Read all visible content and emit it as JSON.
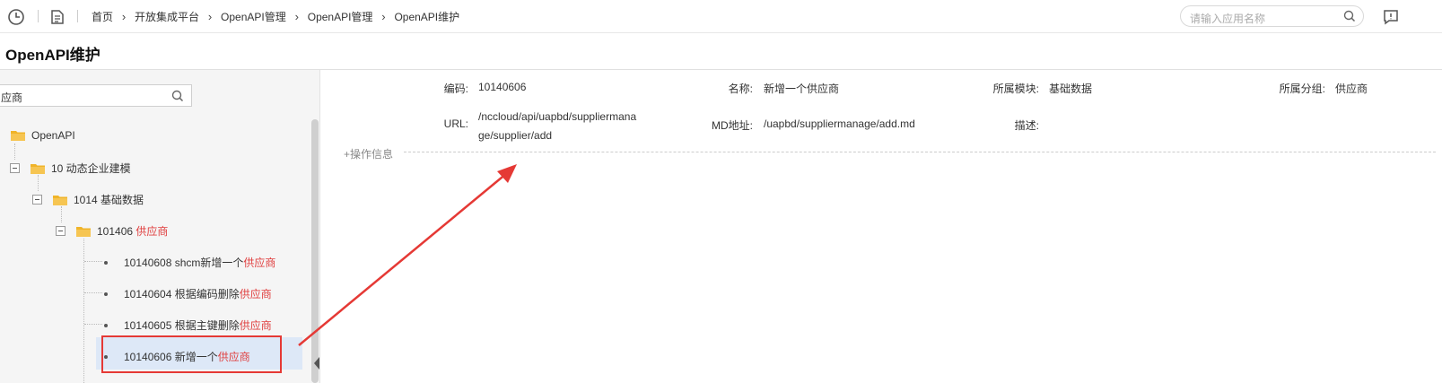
{
  "header": {
    "breadcrumb": [
      "首页",
      "开放集成平台",
      "OpenAPI管理",
      "OpenAPI管理",
      "OpenAPI维护"
    ],
    "search_placeholder": "请输入应用名称"
  },
  "page": {
    "title": "OpenAPI维护"
  },
  "tree": {
    "search_value": "应商",
    "nodes": {
      "root": {
        "label": "OpenAPI"
      },
      "n10": {
        "label": "10 动态企业建模"
      },
      "n1014": {
        "label": "1014 基础数据"
      },
      "n101406": {
        "code": "101406 ",
        "match": "供应商"
      },
      "leaf1": {
        "prefix": "10140608 shcm新增一个",
        "match": "供应商"
      },
      "leaf2": {
        "prefix": "10140604 根据编码删除",
        "match": "供应商"
      },
      "leaf3": {
        "prefix": "10140605 根据主键删除",
        "match": "供应商"
      },
      "leaf4": {
        "prefix": "10140606 新增一个",
        "match": "供应商"
      }
    }
  },
  "detail": {
    "code": {
      "label": "编码:",
      "value": "10140606"
    },
    "name": {
      "label": "名称:",
      "value": "新增一个供应商"
    },
    "module": {
      "label": "所属模块:",
      "value": "基础数据"
    },
    "group": {
      "label": "所属分组:",
      "value": "供应商"
    },
    "url": {
      "label": "URL:",
      "value": "/nccloud/api/uapbd/suppliermanage/supplier/add"
    },
    "md": {
      "label": "MD地址:",
      "value": "/uapbd/suppliermanage/add.md"
    },
    "desc": {
      "label": "描述:",
      "value": ""
    },
    "section_title": "+操作信息"
  },
  "colors": {
    "highlight": "#e04040",
    "annotation": "#e53935",
    "selection": "#dde8f7",
    "folder": "#f0b429"
  },
  "icons": [
    "clock-icon",
    "document-list-icon",
    "search-icon",
    "message-icon",
    "folder-icon",
    "collapse-handle-icon"
  ]
}
